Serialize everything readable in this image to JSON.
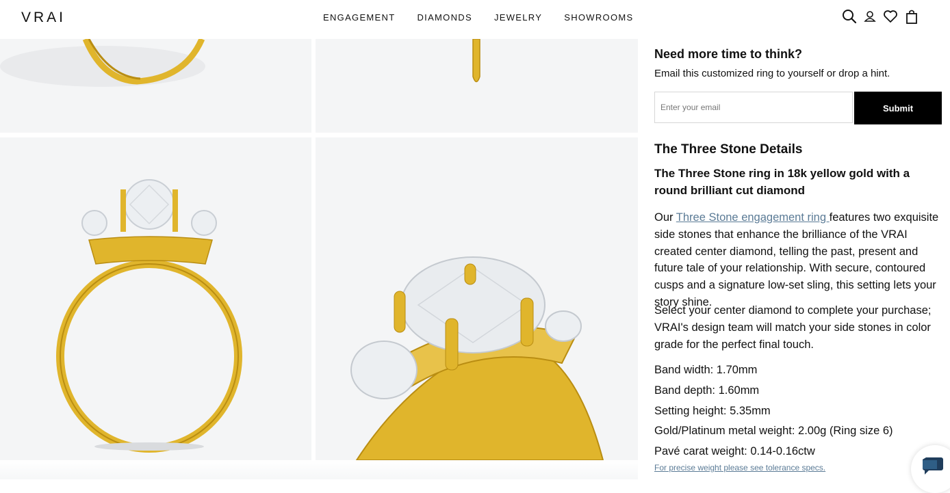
{
  "brand": "VRAI",
  "nav": [
    "ENGAGEMENT",
    "DIAMONDS",
    "JEWELRY",
    "SHOWROOMS"
  ],
  "header_icons": [
    "search-icon",
    "account-icon",
    "heart-icon",
    "bag-icon"
  ],
  "email_capture": {
    "title": "Need more time to think?",
    "subtitle": "Email this customized ring to yourself or drop a hint.",
    "placeholder": "Enter your email",
    "submit_label": "Submit"
  },
  "details": {
    "heading": "The Three Stone Details",
    "lead": "The Three Stone ring in 18k yellow gold with a round brilliant cut diamond",
    "desc_prefix": "Our ",
    "desc_link": "Three Stone engagement ring ",
    "desc_suffix": "features two exquisite side stones that enhance the brilliance of the VRAI created center diamond, telling the past, present and future tale of your relationship. With secure, contoured cusps and a signature low-set sling, this setting lets your story shine.",
    "select_text": "Select your center diamond to complete your purchase; VRAI's design team will match your side stones in color grade for the perfect final touch.",
    "specs": [
      "Band width: 1.70mm",
      "Band depth: 1.60mm",
      "Setting height: 5.35mm",
      "Gold/Platinum metal weight: 2.00g (Ring size 6)",
      "Pavé carat weight: 0.14-0.16ctw"
    ],
    "tolerance_link": "For precise weight please see tolerance specs."
  },
  "colors": {
    "gold": "#e0b52c",
    "gold_dark": "#b98d12",
    "link": "#5b7b96",
    "tile_bg": "#f4f5f6"
  }
}
